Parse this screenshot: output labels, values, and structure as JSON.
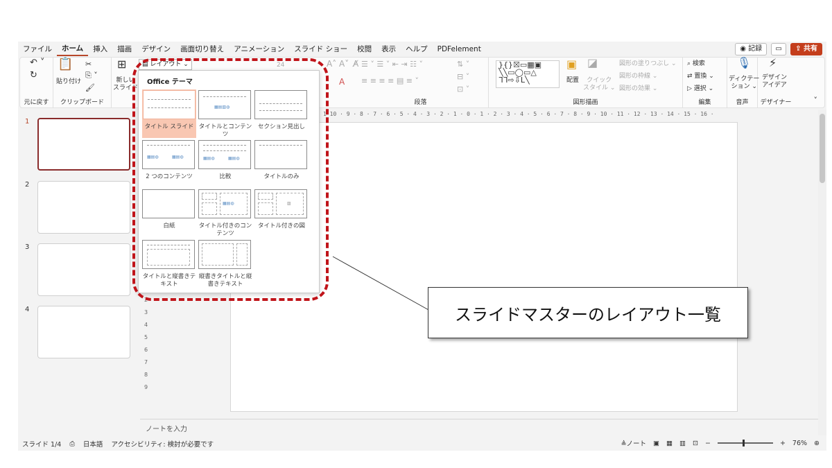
{
  "menu": {
    "tabs": [
      "ファイル",
      "ホーム",
      "挿入",
      "描画",
      "デザイン",
      "画面切り替え",
      "アニメーション",
      "スライド ショー",
      "校閲",
      "表示",
      "ヘルプ",
      "PDFelement"
    ],
    "active_tab": "ホーム",
    "record_label": "◉ 記録",
    "share_label": "⇪ 共有"
  },
  "ribbon": {
    "undo_group": "元に戻す",
    "clipboard_group": "クリップボード",
    "paste_label": "貼り付け",
    "new_slide_label": "新しい\nスライド",
    "layout_label": "レイアウト ⌄",
    "font_size": "24",
    "paragraph_group": "段落",
    "drawing_group": "図形描画",
    "arrange_label": "配置",
    "quick_style_label": "クイック\nスタイル ⌄",
    "shape_fill": "図形の塗りつぶし ⌄",
    "shape_outline": "図形の枠線 ⌄",
    "shape_effects": "図形の効果 ⌄",
    "find_label": "検索",
    "replace_label": "置換 ⌄",
    "select_label": "選択 ⌄",
    "editing_group": "編集",
    "dictate_label": "ディクテー\nション ⌄",
    "voice_group": "音声",
    "designer_label": "デザイン\nアイデア",
    "designer_group": "デザイナー"
  },
  "slides": {
    "numbers": [
      "1",
      "2",
      "3",
      "4"
    ],
    "active": 1
  },
  "ruler_text": "1 10 · 9 · 8 · 7 · 6 · 5 · 4 · 3 · 2 · 1 · 0 · 1 · 2 · 3 · 4 · 5 · 6 · 7 · 8 · 9 · 10 · 11 · 12 · 13 · 14 · 15 · 16 ·",
  "notes_placeholder": "ノートを入力",
  "status": {
    "slide_count": "スライド 1/4",
    "language": "日本語",
    "accessibility": "アクセシビリティ: 検討が必要です",
    "notes_label": "≜ノート",
    "zoom": "76%"
  },
  "gallery": {
    "title": "Office テーマ",
    "layouts": [
      {
        "label": "タイトル スライド",
        "selected": true
      },
      {
        "label": "タイトルとコンテンツ",
        "selected": false
      },
      {
        "label": "セクション見出し",
        "selected": false
      },
      {
        "label": "2 つのコンテンツ",
        "selected": false
      },
      {
        "label": "比較",
        "selected": false
      },
      {
        "label": "タイトルのみ",
        "selected": false
      },
      {
        "label": "白紙",
        "selected": false
      },
      {
        "label": "タイトル付きのコンテンツ",
        "selected": false
      },
      {
        "label": "タイトル付きの図",
        "selected": false
      },
      {
        "label": "タイトルと縦書きテキスト",
        "selected": false
      },
      {
        "label": "縦書きタイトルと縦書きテキスト",
        "selected": false
      }
    ]
  },
  "callout_text": "スライドマスターのレイアウト一覧",
  "colors": {
    "accent": "#b7472a",
    "highlight_outline": "#c0141a",
    "selected_tile": "#f9c7b2",
    "share_button": "#c43e1c"
  }
}
